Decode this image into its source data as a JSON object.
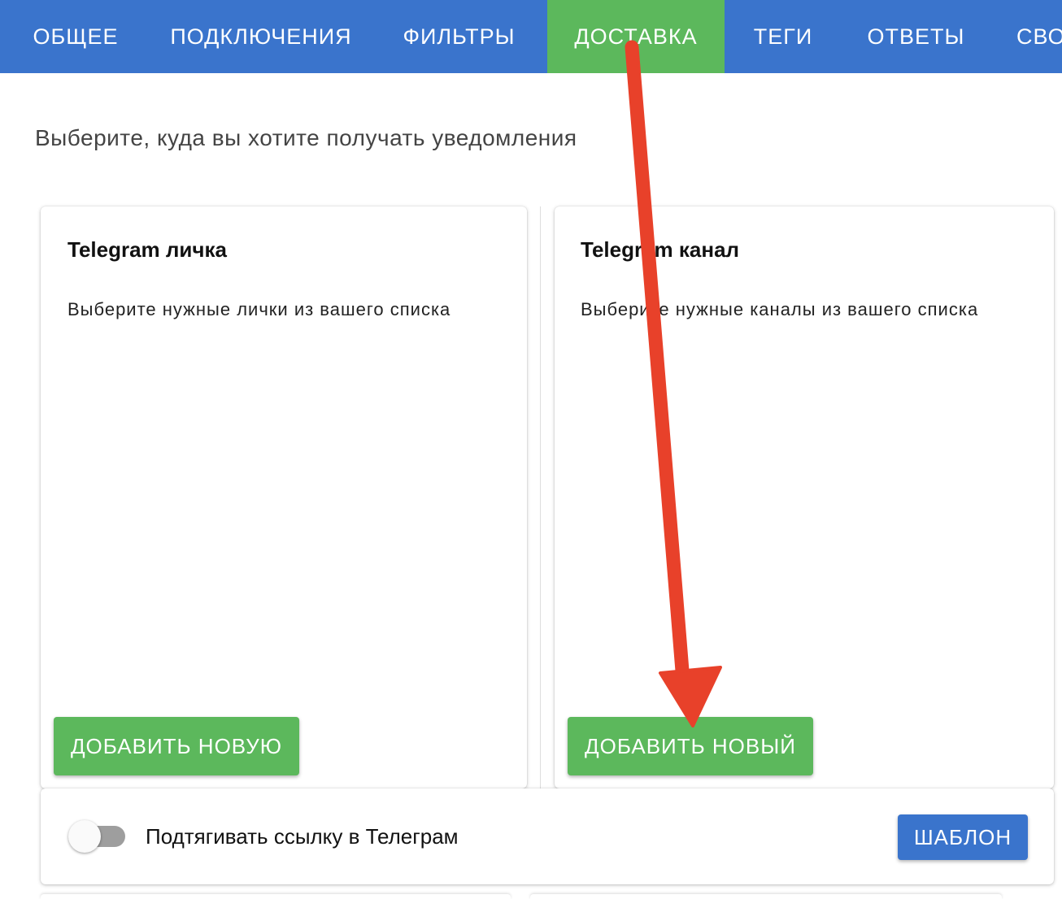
{
  "tabs": [
    {
      "label": "ОБЩЕЕ"
    },
    {
      "label": "ПОДКЛЮЧЕНИЯ"
    },
    {
      "label": "ФИЛЬТРЫ"
    },
    {
      "label": "ДОСТАВКА",
      "active": true
    },
    {
      "label": "ТЕГИ"
    },
    {
      "label": "ОТВЕТЫ"
    },
    {
      "label": "СВО"
    }
  ],
  "page": {
    "subtitle": "Выберите, куда вы хотите получать уведомления"
  },
  "cards": [
    {
      "title": "Telegram личка",
      "text": "Выберите нужные лички из вашего списка",
      "button": "ДОБАВИТЬ НОВУЮ"
    },
    {
      "title": "Telegram канал",
      "text": "Выберите нужные каналы из вашего списка",
      "button": "ДОБАВИТЬ НОВЫЙ"
    }
  ],
  "options": {
    "toggle_label": "Подтягивать ссылку в Телеграм",
    "toggle_on": false,
    "template_button": "ШАБЛОН"
  },
  "colors": {
    "header": "#3a74cc",
    "active_tab": "#5cb85c",
    "green_button": "#5cb85c",
    "blue_button": "#3a74cc",
    "annotation_arrow": "#e8412a"
  }
}
